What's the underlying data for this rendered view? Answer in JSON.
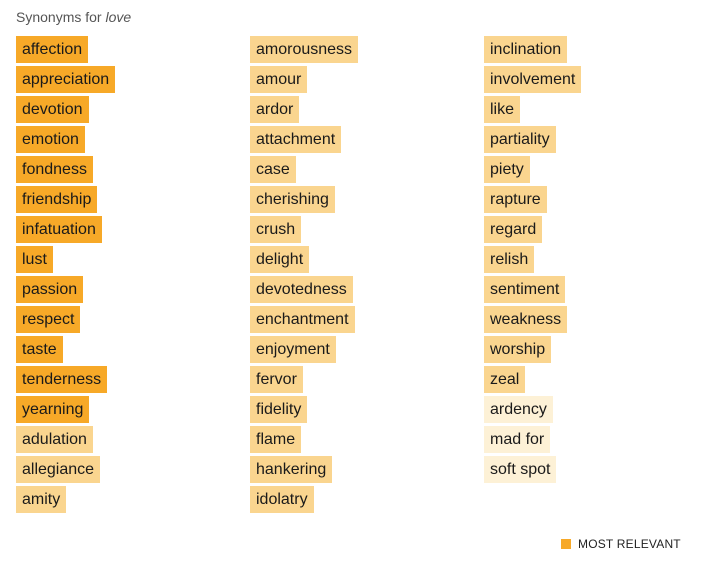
{
  "heading": {
    "prefix": "Synonyms for",
    "word": "love"
  },
  "columns": [
    [
      {
        "word": "affection",
        "relevance": 1
      },
      {
        "word": "appreciation",
        "relevance": 1
      },
      {
        "word": "devotion",
        "relevance": 1
      },
      {
        "word": "emotion",
        "relevance": 1
      },
      {
        "word": "fondness",
        "relevance": 1
      },
      {
        "word": "friendship",
        "relevance": 1
      },
      {
        "word": "infatuation",
        "relevance": 1
      },
      {
        "word": "lust",
        "relevance": 1
      },
      {
        "word": "passion",
        "relevance": 1
      },
      {
        "word": "respect",
        "relevance": 1
      },
      {
        "word": "taste",
        "relevance": 1
      },
      {
        "word": "tenderness",
        "relevance": 1
      },
      {
        "word": "yearning",
        "relevance": 1
      },
      {
        "word": "adulation",
        "relevance": 2
      },
      {
        "word": "allegiance",
        "relevance": 2
      },
      {
        "word": "amity",
        "relevance": 2
      }
    ],
    [
      {
        "word": "amorousness",
        "relevance": 2
      },
      {
        "word": "amour",
        "relevance": 2
      },
      {
        "word": "ardor",
        "relevance": 2
      },
      {
        "word": "attachment",
        "relevance": 2
      },
      {
        "word": "case",
        "relevance": 2
      },
      {
        "word": "cherishing",
        "relevance": 2
      },
      {
        "word": "crush",
        "relevance": 2
      },
      {
        "word": "delight",
        "relevance": 2
      },
      {
        "word": "devotedness",
        "relevance": 2
      },
      {
        "word": "enchantment",
        "relevance": 2
      },
      {
        "word": "enjoyment",
        "relevance": 2
      },
      {
        "word": "fervor",
        "relevance": 2
      },
      {
        "word": "fidelity",
        "relevance": 2
      },
      {
        "word": "flame",
        "relevance": 2
      },
      {
        "word": "hankering",
        "relevance": 2
      },
      {
        "word": "idolatry",
        "relevance": 2
      }
    ],
    [
      {
        "word": "inclination",
        "relevance": 2
      },
      {
        "word": "involvement",
        "relevance": 2
      },
      {
        "word": "like",
        "relevance": 2
      },
      {
        "word": "partiality",
        "relevance": 2
      },
      {
        "word": "piety",
        "relevance": 2
      },
      {
        "word": "rapture",
        "relevance": 2
      },
      {
        "word": "regard",
        "relevance": 2
      },
      {
        "word": "relish",
        "relevance": 2
      },
      {
        "word": "sentiment",
        "relevance": 2
      },
      {
        "word": "weakness",
        "relevance": 2
      },
      {
        "word": "worship",
        "relevance": 2
      },
      {
        "word": "zeal",
        "relevance": 2
      },
      {
        "word": "ardency",
        "relevance": 3
      },
      {
        "word": "mad for",
        "relevance": 3
      },
      {
        "word": "soft spot",
        "relevance": 3
      }
    ]
  ],
  "relevance_colors": {
    "1": "#f7a928",
    "2": "#fad58f",
    "3": "#fdf1d6"
  },
  "legend": {
    "label": "MOST RELEVANT",
    "swatch_color": "#f7a928"
  }
}
